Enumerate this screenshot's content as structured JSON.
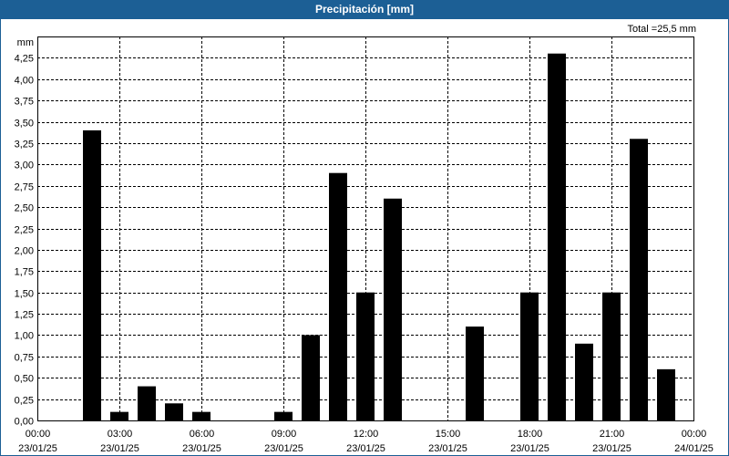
{
  "window": {
    "title": "Precipitación [mm]"
  },
  "total_label": "Total =25,5 mm",
  "colors": {
    "titlebar": "#1c5f95",
    "bars": "#000000",
    "grid": "#000000"
  },
  "chart_data": {
    "type": "bar",
    "title": "Precipitación [mm]",
    "ylabel": "mm",
    "xlabel": "",
    "ylim": [
      0,
      4.5
    ],
    "yticks": [
      "0,00",
      "0,25",
      "0,50",
      "0,75",
      "1,00",
      "1,25",
      "1,50",
      "1,75",
      "2,00",
      "2,25",
      "2,50",
      "2,75",
      "3,00",
      "3,25",
      "3,50",
      "3,75",
      "4,00",
      "4,25"
    ],
    "xticks": [
      {
        "time": "00:00",
        "date": "23/01/25"
      },
      {
        "time": "03:00",
        "date": "23/01/25"
      },
      {
        "time": "06:00",
        "date": "23/01/25"
      },
      {
        "time": "09:00",
        "date": "23/01/25"
      },
      {
        "time": "12:00",
        "date": "23/01/25"
      },
      {
        "time": "15:00",
        "date": "23/01/25"
      },
      {
        "time": "18:00",
        "date": "23/01/25"
      },
      {
        "time": "21:00",
        "date": "23/01/25"
      },
      {
        "time": "00:00",
        "date": "24/01/25"
      }
    ],
    "hours": [
      "02:00",
      "03:00",
      "04:00",
      "05:00",
      "06:00",
      "09:00",
      "10:00",
      "11:00",
      "12:00",
      "13:00",
      "16:00",
      "18:00",
      "19:00",
      "20:00",
      "21:00",
      "22:00",
      "23:00"
    ],
    "values": [
      3.4,
      0.1,
      0.4,
      0.2,
      0.1,
      0.1,
      1.0,
      2.9,
      1.5,
      2.6,
      1.1,
      1.5,
      4.3,
      0.9,
      1.5,
      3.3,
      0.6
    ],
    "grid": true
  }
}
